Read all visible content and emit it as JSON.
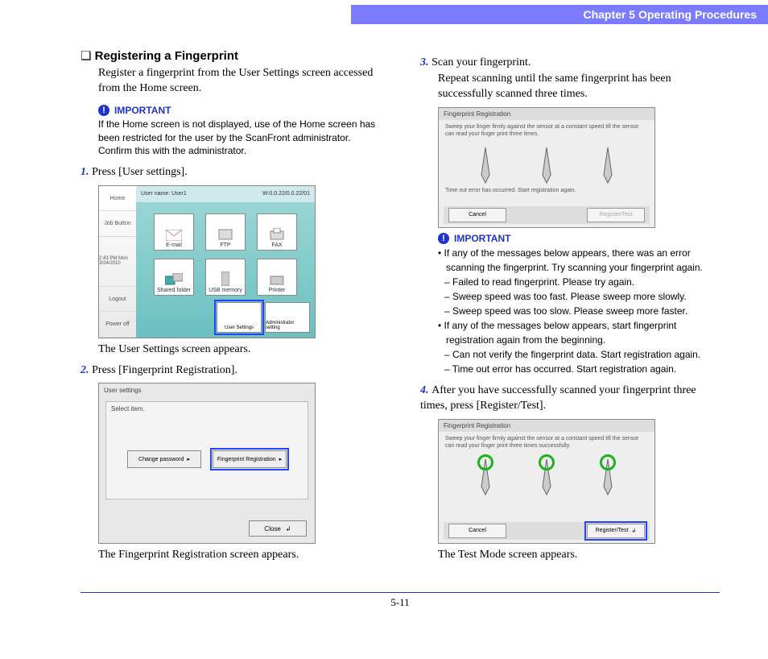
{
  "header": {
    "chapter": "Chapter 5   Operating Procedures"
  },
  "section": {
    "title": "Registering a Fingerprint",
    "intro": "Register a fingerprint from the User Settings screen accessed from the Home screen.",
    "important_label": "IMPORTANT",
    "important_note": "If the Home screen is not displayed, use of the Home screen has been restricted for the user by the ScanFront administrator. Confirm this with the administrator."
  },
  "step1": {
    "num": "1.",
    "text": "Press [User settings].",
    "caption": "The User Settings screen appears.",
    "shot": {
      "sidebar": [
        "Home",
        "Job Button",
        "",
        "",
        "Logout",
        "Power off"
      ],
      "topbar_left": "User name: User1",
      "topbar_right": "W:0.0.22/0.0.22/01",
      "time": "2:43 PM  Mon 3/24/2010",
      "icons_top": [
        "E-mail",
        "FTP",
        "FAX"
      ],
      "icons_bot": [
        "Shared folder",
        "USB memory",
        "Printer"
      ],
      "bottom": [
        "User Settings",
        "Administrator setting"
      ]
    }
  },
  "step2": {
    "num": "2.",
    "text": "Press [Fingerprint Registration].",
    "caption": "The Fingerprint Registration screen appears.",
    "shot": {
      "title": "User settings",
      "sub": "Select item.",
      "btn_left": "Change password",
      "btn_right": "Fingerprint Registration",
      "close": "Close"
    }
  },
  "step3": {
    "num": "3.",
    "text": "Scan your fingerprint.",
    "body": "Repeat scanning until the same fingerprint has been successfully scanned three times.",
    "shot": {
      "title": "Fingerprint Registration",
      "msg": "Sweep your finger firmly against the sensor at a constant speed till the sensor can read your finger print three times.",
      "err": "Time out error has occurred. Start registration again.",
      "cancel": "Cancel",
      "register": "Register/Test"
    },
    "important_label": "IMPORTANT",
    "bullets": [
      "If any of the messages below appears, there was an error scanning the fingerprint. Try scanning your fingerprint again.",
      "– Failed to read fingerprint. Please try again.",
      "– Sweep speed was too fast. Please sweep more slowly.",
      "– Sweep speed was too slow. Please sweep more faster.",
      "If any of the messages below appears, start fingerprint registration again from the beginning.",
      "– Can not verify the fingerprint data. Start registration again.",
      "– Time out error has occurred. Start registration again."
    ]
  },
  "step4": {
    "num": "4.",
    "text": "After you have successfully scanned your fingerprint three times, press [Register/Test].",
    "caption": "The Test Mode screen appears.",
    "shot": {
      "title": "Fingerprint Registration",
      "msg": "Sweep your finger firmly against the sensor at a constant speed till the sensor can read your finger print three times successfully.",
      "cancel": "Cancel",
      "register": "Register/Test"
    }
  },
  "footer": {
    "page": "5-11"
  }
}
